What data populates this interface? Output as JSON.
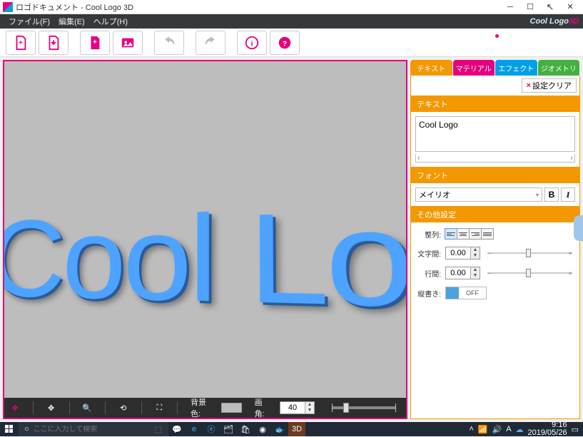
{
  "window": {
    "title": "ロゴドキュメント - Cool Logo 3D"
  },
  "menu": {
    "file": "ファイル(F)",
    "edit": "編集(E)",
    "help": "ヘルプ(H)"
  },
  "brand": {
    "cool": "Cool",
    "logo": "Logo",
    "td": "3D"
  },
  "viewport": {
    "logoText": "Cool Logo"
  },
  "viewbar": {
    "bgLabel": "背景色:",
    "angleLabel": "画角:",
    "angleValue": "40"
  },
  "tabs": {
    "text": "テキスト",
    "material": "マテリアル",
    "effect": "エフェクト",
    "geometry": "ジオメトリ"
  },
  "clear": {
    "label": "設定クリア"
  },
  "sec": {
    "text": "テキスト",
    "font": "フォント",
    "other": "その他設定"
  },
  "input": {
    "text": "Cool Logo"
  },
  "font": {
    "name": "メイリオ",
    "bold": "B",
    "italic": "I"
  },
  "other": {
    "alignLabel": "整列:",
    "charSpacingLabel": "文字間:",
    "charSpacingValue": "0.00",
    "lineSpacingLabel": "行間:",
    "lineSpacingValue": "0.00",
    "verticalLabel": "縦書き:",
    "toggleOff": "OFF"
  },
  "taskbar": {
    "searchPlaceholder": "ここに入力して検索",
    "time": "9:16",
    "date": "2019/05/26"
  }
}
